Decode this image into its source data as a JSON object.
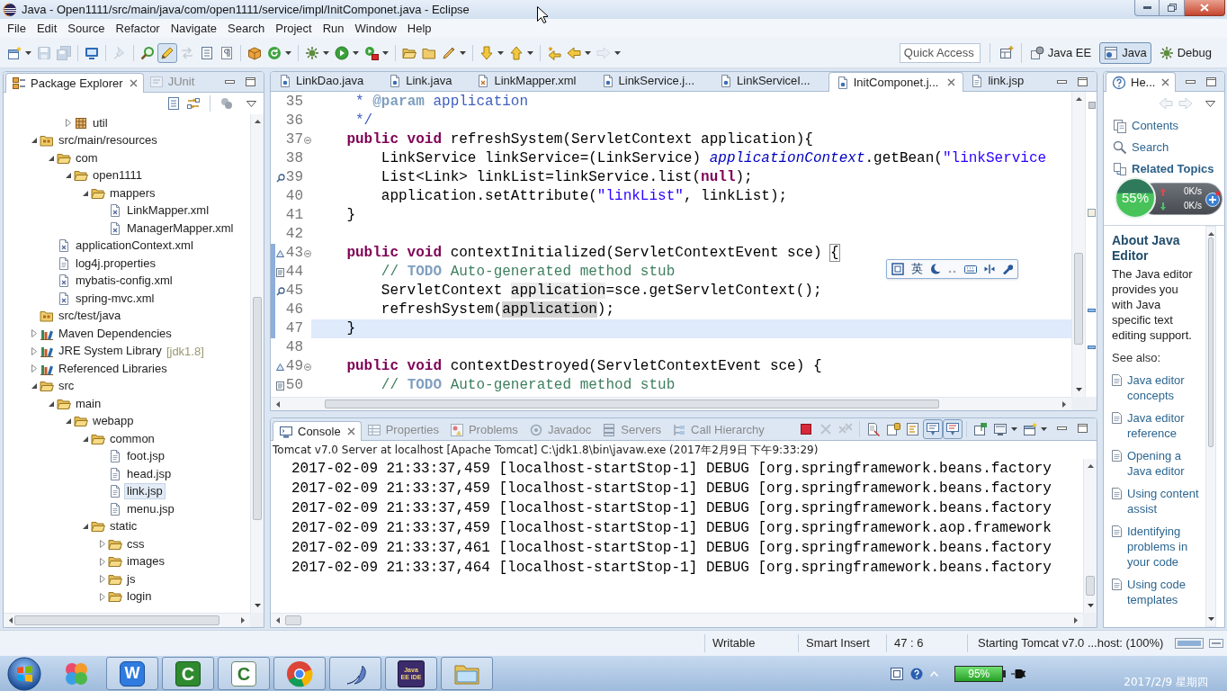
{
  "window": {
    "title": "Java - Open1111/src/main/java/com/open1111/service/impl/InitComponet.java - Eclipse"
  },
  "menu": [
    "File",
    "Edit",
    "Source",
    "Refactor",
    "Navigate",
    "Search",
    "Project",
    "Run",
    "Window",
    "Help"
  ],
  "toolbar": [
    {
      "kind": "new",
      "dropdown": true,
      "disabled": false,
      "pressed": false
    },
    {
      "kind": "save",
      "dropdown": false,
      "disabled": true,
      "pressed": false
    },
    {
      "kind": "save-all",
      "dropdown": false,
      "disabled": true,
      "pressed": false
    },
    {
      "kind": "separator"
    },
    {
      "kind": "terminal",
      "dropdown": false,
      "disabled": false,
      "pressed": false
    },
    {
      "kind": "separator"
    },
    {
      "kind": "pin",
      "dropdown": false,
      "disabled": true,
      "pressed": false
    },
    {
      "kind": "separator"
    },
    {
      "kind": "magnifier",
      "dropdown": false,
      "disabled": false,
      "pressed": false
    },
    {
      "kind": "highlighter",
      "dropdown": false,
      "disabled": false,
      "pressed": true
    },
    {
      "kind": "arrows",
      "dropdown": false,
      "disabled": true,
      "pressed": false
    },
    {
      "kind": "block",
      "dropdown": false,
      "disabled": false,
      "pressed": false
    },
    {
      "kind": "pilcrow",
      "dropdown": false,
      "disabled": false,
      "pressed": false
    },
    {
      "kind": "separator"
    },
    {
      "kind": "package",
      "dropdown": false,
      "disabled": false,
      "pressed": false
    },
    {
      "kind": "refresh",
      "dropdown": true,
      "disabled": false,
      "pressed": false
    },
    {
      "kind": "separator"
    },
    {
      "kind": "bug",
      "dropdown": true,
      "disabled": false,
      "pressed": false
    },
    {
      "kind": "run",
      "dropdown": true,
      "disabled": false,
      "pressed": false
    },
    {
      "kind": "tools",
      "dropdown": true,
      "disabled": false,
      "pressed": false
    },
    {
      "kind": "separator"
    },
    {
      "kind": "folder-open",
      "dropdown": false,
      "disabled": false,
      "pressed": false
    },
    {
      "kind": "folder",
      "dropdown": false,
      "disabled": false,
      "pressed": false
    },
    {
      "kind": "pen",
      "dropdown": true,
      "disabled": false,
      "pressed": false
    },
    {
      "kind": "separator"
    },
    {
      "kind": "down-arrow",
      "dropdown": true,
      "disabled": false,
      "pressed": false
    },
    {
      "kind": "up-arrow",
      "dropdown": true,
      "disabled": false,
      "pressed": false
    },
    {
      "kind": "separator"
    },
    {
      "kind": "star-arrow",
      "dropdown": false,
      "disabled": false,
      "pressed": false
    },
    {
      "kind": "left-arrow",
      "dropdown": true,
      "disabled": false,
      "pressed": false
    },
    {
      "kind": "right-arrow",
      "dropdown": true,
      "disabled": true,
      "pressed": false
    }
  ],
  "quick_access": {
    "placeholder": "Quick Access"
  },
  "perspectives": [
    {
      "kind": "javaee",
      "label": "Java EE",
      "selected": false
    },
    {
      "kind": "java",
      "label": "Java",
      "selected": true
    },
    {
      "kind": "debug",
      "label": "Debug",
      "selected": false
    }
  ],
  "package_explorer": {
    "tabs": [
      {
        "kind": "explorer",
        "label": "Package Explorer",
        "selected": true
      },
      {
        "kind": "junit",
        "label": "JUnit",
        "selected": false
      }
    ],
    "tree": [
      {
        "children": [
          {
            "children": [
              {
                "children": [
                  {
                    "label": "util",
                    "kind": "package",
                    "expanded": false,
                    "selected": false
                  }
                ]
              }
            ]
          },
          {
            "label": "src/main/resources",
            "kind": "source-folder",
            "expanded": true,
            "selected": false,
            "children": [
              {
                "label": "com",
                "kind": "folder",
                "expanded": true,
                "selected": false,
                "children": [
                  {
                    "label": "open1111",
                    "kind": "folder",
                    "expanded": true,
                    "selected": false,
                    "children": [
                      {
                        "label": "mappers",
                        "kind": "folder",
                        "expanded": true,
                        "selected": false,
                        "children": [
                          {
                            "label": "LinkMapper.xml",
                            "kind": "xml",
                            "selected": false
                          },
                          {
                            "label": "ManagerMapper.xml",
                            "kind": "xml",
                            "selected": false
                          }
                        ]
                      }
                    ]
                  }
                ]
              },
              {
                "label": "applicationContext.xml",
                "kind": "xml",
                "selected": false
              },
              {
                "label": "log4j.properties",
                "kind": "text",
                "selected": false
              },
              {
                "label": "mybatis-config.xml",
                "kind": "xml",
                "selected": false
              },
              {
                "label": "spring-mvc.xml",
                "kind": "xml",
                "selected": false
              }
            ]
          },
          {
            "label": "src/test/java",
            "kind": "source-folder",
            "selected": false
          },
          {
            "label": "Maven Dependencies",
            "kind": "library",
            "expanded": false,
            "selected": false
          },
          {
            "label": "JRE System Library",
            "decoration": "[jdk1.8]",
            "kind": "library",
            "expanded": false,
            "selected": false
          },
          {
            "label": "Referenced Libraries",
            "kind": "library",
            "expanded": false,
            "selected": false
          },
          {
            "label": "src",
            "kind": "folder",
            "expanded": true,
            "selected": false,
            "children": [
              {
                "label": "main",
                "kind": "folder",
                "expanded": true,
                "selected": false,
                "children": [
                  {
                    "label": "webapp",
                    "kind": "folder",
                    "expanded": true,
                    "selected": false,
                    "children": [
                      {
                        "label": "common",
                        "kind": "folder",
                        "expanded": true,
                        "selected": false,
                        "children": [
                          {
                            "label": "foot.jsp",
                            "kind": "text",
                            "selected": false
                          },
                          {
                            "label": "head.jsp",
                            "kind": "text",
                            "selected": false
                          },
                          {
                            "label": "link.jsp",
                            "kind": "text",
                            "selected": true
                          },
                          {
                            "label": "menu.jsp",
                            "kind": "text",
                            "selected": false
                          }
                        ]
                      },
                      {
                        "label": "static",
                        "kind": "folder",
                        "expanded": true,
                        "selected": false,
                        "children": [
                          {
                            "label": "css",
                            "kind": "folder",
                            "expanded": false,
                            "selected": false
                          },
                          {
                            "label": "images",
                            "kind": "folder",
                            "expanded": false,
                            "selected": false
                          },
                          {
                            "label": "js",
                            "kind": "folder",
                            "expanded": false,
                            "selected": false
                          },
                          {
                            "label": "login",
                            "kind": "folder",
                            "expanded": false,
                            "selected": false
                          }
                        ]
                      }
                    ]
                  }
                ]
              }
            ]
          }
        ]
      }
    ]
  },
  "editor": {
    "tabs": [
      {
        "kind": "java",
        "label": "LinkDao.java",
        "selected": false
      },
      {
        "kind": "java",
        "label": "Link.java",
        "selected": false
      },
      {
        "kind": "xml",
        "label": "LinkMapper.xml",
        "selected": false
      },
      {
        "kind": "java",
        "label": "LinkService.j...",
        "selected": false
      },
      {
        "kind": "java",
        "label": "LinkServiceI...",
        "selected": false
      },
      {
        "kind": "java",
        "label": "InitComponet.j...",
        "selected": true
      },
      {
        "kind": "jsp",
        "label": "link.jsp",
        "selected": false
      }
    ],
    "lines": [
      {
        "number": "35",
        "segments": [
          {
            "kind": "doc",
            "text": "     * "
          },
          {
            "kind": "doc-tag",
            "text": "@param"
          },
          {
            "kind": "doc",
            "text": " application"
          }
        ],
        "current": false,
        "changed": false,
        "fold": false
      },
      {
        "number": "36",
        "segments": [
          {
            "kind": "doc",
            "text": "     */"
          }
        ],
        "current": false,
        "changed": false,
        "fold": false
      },
      {
        "number": "37",
        "segments": [
          {
            "kind": "keyword",
            "text": "    public"
          },
          {
            "kind": "keyword",
            "text": " void"
          },
          {
            "kind": "plain",
            "text": " refreshSystem(ServletContext application){"
          }
        ],
        "current": false,
        "changed": false,
        "fold": true
      },
      {
        "number": "38",
        "segments": [
          {
            "kind": "plain",
            "text": "        LinkService linkService=(LinkService) "
          },
          {
            "kind": "static",
            "text": "applicationContext"
          },
          {
            "kind": "plain",
            "text": ".getBean("
          },
          {
            "kind": "string",
            "text": "\"linkService"
          }
        ],
        "current": false,
        "changed": false,
        "fold": false
      },
      {
        "number": "39",
        "marker": {
          "kind": "occurrence"
        },
        "segments": [
          {
            "kind": "plain",
            "text": "        List<Link> linkList=linkService.list("
          },
          {
            "kind": "keyword",
            "text": "null"
          },
          {
            "kind": "plain",
            "text": ");"
          }
        ],
        "current": false,
        "changed": false,
        "fold": false
      },
      {
        "number": "40",
        "segments": [
          {
            "kind": "plain",
            "text": "        application.setAttribute("
          },
          {
            "kind": "string",
            "text": "\"linkList\""
          },
          {
            "kind": "plain",
            "text": ", linkList);"
          }
        ],
        "current": false,
        "changed": false,
        "fold": false
      },
      {
        "number": "41",
        "segments": [
          {
            "kind": "plain",
            "text": "    }"
          }
        ],
        "current": false,
        "changed": false,
        "fold": false
      },
      {
        "number": "42",
        "current": false,
        "changed": false,
        "fold": false
      },
      {
        "number": "43",
        "marker": {
          "kind": "override"
        },
        "segments": [
          {
            "kind": "keyword",
            "text": "    public"
          },
          {
            "kind": "keyword",
            "text": " void"
          },
          {
            "kind": "plain",
            "text": " contextInitialized(ServletContextEvent sce) "
          },
          {
            "kind": "bracket",
            "text": "{"
          }
        ],
        "current": false,
        "changed": true,
        "fold": true
      },
      {
        "number": "44",
        "marker": {
          "kind": "task"
        },
        "segments": [
          {
            "kind": "comment",
            "text": "        // "
          },
          {
            "kind": "todo",
            "text": "TODO"
          },
          {
            "kind": "comment",
            "text": " Auto-generated method stub"
          }
        ],
        "current": false,
        "changed": true,
        "fold": false
      },
      {
        "number": "45",
        "marker": {
          "kind": "occurrence"
        },
        "segments": [
          {
            "kind": "plain",
            "text": "        ServletContext "
          },
          {
            "kind": "write-occurrence",
            "text": "application"
          },
          {
            "kind": "plain",
            "text": "=sce.getServletContext();"
          }
        ],
        "current": false,
        "changed": true,
        "fold": false
      },
      {
        "number": "46",
        "segments": [
          {
            "kind": "plain",
            "text": "        refreshSystem("
          },
          {
            "kind": "read-occurrence",
            "text": "application"
          },
          {
            "kind": "plain",
            "text": ");"
          }
        ],
        "current": false,
        "changed": true,
        "fold": false
      },
      {
        "number": "47",
        "segments": [
          {
            "kind": "plain",
            "text": "    }"
          }
        ],
        "current": true,
        "changed": true,
        "fold": false
      },
      {
        "number": "48",
        "current": false,
        "changed": false,
        "fold": false
      },
      {
        "number": "49",
        "marker": {
          "kind": "override"
        },
        "segments": [
          {
            "kind": "keyword",
            "text": "    public"
          },
          {
            "kind": "keyword",
            "text": " void"
          },
          {
            "kind": "plain",
            "text": " contextDestroyed(ServletContextEvent sce) {"
          }
        ],
        "current": false,
        "changed": false,
        "fold": true
      },
      {
        "number": "50",
        "marker": {
          "kind": "task"
        },
        "segments": [
          {
            "kind": "comment",
            "text": "        // "
          },
          {
            "kind": "todo",
            "text": "TODO"
          },
          {
            "kind": "comment",
            "text": " Auto-generated method stub"
          }
        ],
        "current": false,
        "changed": false,
        "fold": false
      }
    ]
  },
  "ime_toolbar": {
    "mode": "英"
  },
  "console": {
    "tabs": [
      {
        "kind": "console",
        "label": "Console",
        "selected": true
      },
      {
        "kind": "properties",
        "label": "Properties",
        "selected": false
      },
      {
        "kind": "problems",
        "label": "Problems",
        "selected": false
      },
      {
        "kind": "javadoc",
        "label": "Javadoc",
        "selected": false
      },
      {
        "kind": "servers",
        "label": "Servers",
        "selected": false
      },
      {
        "kind": "hierarchy",
        "label": "Call Hierarchy",
        "selected": false
      }
    ],
    "toolbar": [
      {
        "kind": "stop",
        "dropdown": false,
        "disabled": false,
        "pressed": false
      },
      {
        "kind": "remove",
        "dropdown": false,
        "disabled": true,
        "pressed": false
      },
      {
        "kind": "remove-all",
        "dropdown": false,
        "disabled": true,
        "pressed": false
      },
      {
        "kind": "separator"
      },
      {
        "kind": "clear",
        "dropdown": false,
        "disabled": false,
        "pressed": false
      },
      {
        "kind": "scroll-lock",
        "dropdown": false,
        "disabled": false,
        "pressed": false
      },
      {
        "kind": "word-wrap",
        "dropdown": false,
        "disabled": false,
        "pressed": false
      },
      {
        "kind": "show-out",
        "dropdown": false,
        "disabled": false,
        "pressed": true
      },
      {
        "kind": "show-err",
        "dropdown": false,
        "disabled": false,
        "pressed": true
      },
      {
        "kind": "separator"
      },
      {
        "kind": "pin",
        "dropdown": false,
        "disabled": false,
        "pressed": false
      },
      {
        "kind": "display",
        "dropdown": true,
        "disabled": false,
        "pressed": false
      },
      {
        "kind": "open-console",
        "dropdown": true,
        "disabled": false,
        "pressed": false
      }
    ],
    "description": "Tomcat v7.0 Server at localhost [Apache Tomcat] C:\\jdk1.8\\bin\\javaw.exe (2017年2月9日 下午9:33:29)",
    "lines": [
      "2017-02-09 21:33:37,459 [localhost-startStop-1] DEBUG [org.springframework.beans.factory",
      "2017-02-09 21:33:37,459 [localhost-startStop-1] DEBUG [org.springframework.beans.factory",
      "2017-02-09 21:33:37,459 [localhost-startStop-1] DEBUG [org.springframework.beans.factory",
      "2017-02-09 21:33:37,459 [localhost-startStop-1] DEBUG [org.springframework.aop.framework",
      "2017-02-09 21:33:37,461 [localhost-startStop-1] DEBUG [org.springframework.beans.factory",
      "2017-02-09 21:33:37,464 [localhost-startStop-1] DEBUG [org.springframework.beans.factory"
    ]
  },
  "help": {
    "tabs": [
      {
        "kind": "help",
        "label": "He...",
        "selected": true
      }
    ],
    "nav_buttons": [
      {
        "kind": "back",
        "disabled": true
      },
      {
        "kind": "forward",
        "disabled": true
      }
    ],
    "sections": [
      {
        "kind": "contents",
        "label": "Contents",
        "selected": false
      },
      {
        "kind": "search",
        "label": "Search",
        "selected": false
      },
      {
        "kind": "related",
        "label": "Related Topics",
        "selected": true
      }
    ],
    "heading": "About Java Editor",
    "body": "The Java editor provides you with Java specific text editing support.",
    "see_also": "See also:",
    "links": [
      "Java editor concepts",
      "Java editor reference",
      "Opening a Java editor",
      "Using content assist",
      "Identifying problems in your code",
      "Using code templates"
    ]
  },
  "speed_widget": {
    "percent": "55%",
    "upload": "0K/s",
    "download": "0K/s"
  },
  "status_bar": {
    "fields": [
      "Writable",
      "Smart Insert",
      "47 : 6"
    ],
    "task": "Starting Tomcat v7.0 ...host: (100%)",
    "progress": {
      "level": 1
    }
  },
  "taskbar": {
    "apps": [
      {
        "kind": "petals",
        "running": false
      },
      {
        "kind": "blue-tile",
        "glyph": "W",
        "running": true
      },
      {
        "kind": "green-tile",
        "glyph": "C",
        "running": true
      },
      {
        "kind": "white-tile",
        "glyph": "C",
        "running": true
      },
      {
        "kind": "browser",
        "running": true
      },
      {
        "kind": "dolphin",
        "running": true
      },
      {
        "kind": "ide-tile",
        "glyph": "Java EE IDE",
        "running": true
      },
      {
        "kind": "explorer",
        "running": true
      }
    ],
    "battery": "95%",
    "date": "2017/2/9 星期四"
  }
}
